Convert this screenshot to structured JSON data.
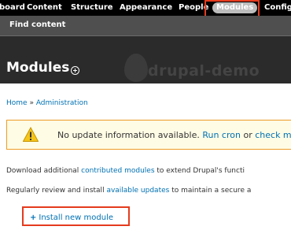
{
  "toolbar": {
    "items": [
      {
        "label": "board"
      },
      {
        "label": "Content"
      },
      {
        "label": "Structure"
      },
      {
        "label": "Appearance"
      },
      {
        "label": "People"
      },
      {
        "label": "Modules",
        "active": true
      },
      {
        "label": "Configu"
      }
    ]
  },
  "shortcuts": {
    "find_content": "Find content"
  },
  "header": {
    "title": "Modules",
    "site_name": "drupal-demo",
    "add_shortcut_icon": "plus-circle-icon"
  },
  "breadcrumb": {
    "home": "Home",
    "separator": " » ",
    "administration": "Administration"
  },
  "message": {
    "icon": "warning-icon",
    "text": "No update information available.",
    "run_cron": "Run cron",
    "or": "or",
    "check": "check m"
  },
  "paragraphs": {
    "download_pre": "Download additional ",
    "download_link": "contributed modules",
    "download_post": " to extend Drupal's functi",
    "review_pre": "Regularly review and install ",
    "review_link": "available updates",
    "review_post": " to maintain a secure a"
  },
  "action": {
    "icon": "plus-icon",
    "label": "Install new module"
  },
  "colors": {
    "toolbar_bg": "#000000",
    "shortcuts_bg": "#4f4f4f",
    "header_bg": "#2b2b2b",
    "link": "#0071b3",
    "highlight": "#e53b1e",
    "warning_bg": "#fffce5",
    "warning_border": "#ed9c28"
  }
}
